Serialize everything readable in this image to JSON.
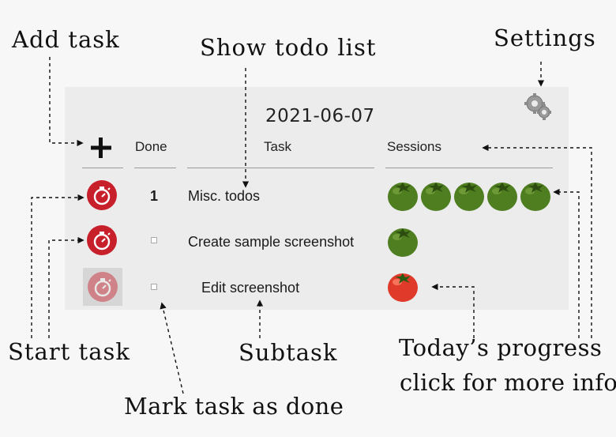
{
  "app": {
    "date": "2021-06-07",
    "headers": {
      "done": "Done",
      "task": "Task",
      "sessions": "Sessions"
    },
    "tasks": [
      {
        "done_label": "1",
        "name": "Misc. todos",
        "sessions": [
          "green",
          "green",
          "green",
          "green",
          "green"
        ]
      },
      {
        "done_label": "",
        "name": "Create sample screenshot",
        "sessions": [
          "green"
        ]
      },
      {
        "done_label": "",
        "name": "Edit screenshot",
        "sessions": [
          "red"
        ],
        "subtask": true
      }
    ]
  },
  "annotations": {
    "add_task": "Add task",
    "show_todo": "Show todo list",
    "settings": "Settings",
    "start_task": "Start task",
    "subtask": "Subtask",
    "progress_line1": "Today’s progress",
    "progress_line2": "click for more info",
    "mark_done": "Mark task as done"
  },
  "colors": {
    "panel": "#ececec",
    "stopwatch_active": "#c8202a",
    "tomato_green": "#4e7e20",
    "tomato_red": "#e03a2a"
  }
}
